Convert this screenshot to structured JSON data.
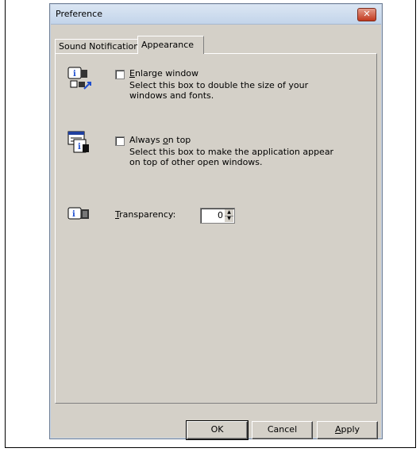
{
  "window": {
    "title": "Preference",
    "close_glyph": "✕"
  },
  "tabs": [
    {
      "label": "Sound Notification",
      "active": false
    },
    {
      "label": "Appearance",
      "active": true
    }
  ],
  "options": {
    "enlarge": {
      "label_pre": "",
      "label_mnemonic": "E",
      "label_post": "nlarge window",
      "checked": false,
      "description": "Select this box to double the size of your windows and fonts.",
      "icon": "enlarge-window-icon"
    },
    "always_on_top": {
      "label_pre": "Always ",
      "label_mnemonic": "o",
      "label_post": "n top",
      "checked": false,
      "description": "Select this box to make the application appear on top of other open windows.",
      "icon": "always-on-top-icon"
    },
    "transparency": {
      "label_mnemonic": "T",
      "label_post": "ransparency:",
      "value": "0",
      "icon": "transparency-icon"
    }
  },
  "buttons": {
    "ok": "OK",
    "cancel": "Cancel",
    "apply_mnemonic": "A",
    "apply_rest": "pply"
  }
}
